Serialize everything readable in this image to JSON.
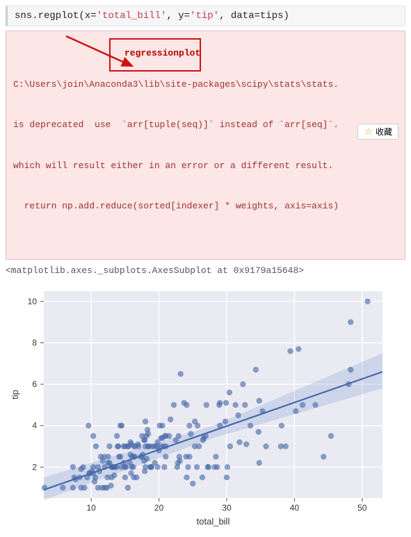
{
  "code": {
    "prefix": "sns.regplot(x=",
    "arg1": "'total_bill'",
    "sep1": ", y=",
    "arg2": "'tip'",
    "sep2": ", data=tips)"
  },
  "warning": {
    "line1": "C:\\Users\\join\\Anaconda3\\lib\\site-packages\\scipy\\stats\\stats.",
    "line2": "is deprecated  use  `arr[tuple(seq)]` instead of `arr[seq]`.",
    "line3": "which will result either in an error or a different result.",
    "line4": "  return np.add.reduce(sorted[indexer] * weights, axis=axis)"
  },
  "annotation": {
    "label": "regressionplot"
  },
  "repr_text": "<matplotlib.axes._subplots.AxesSubplot at 0x9179a15648>",
  "fav_label": "收藏",
  "chart_data": {
    "type": "scatter",
    "xlabel": "total_bill",
    "ylabel": "tip",
    "xlim": [
      3,
      53
    ],
    "ylim": [
      0.5,
      10.5
    ],
    "xticks": [
      10,
      20,
      30,
      40,
      50
    ],
    "yticks": [
      2,
      4,
      6,
      8,
      10
    ],
    "reg_line": {
      "x0": 3,
      "y0": 0.9,
      "x1": 53,
      "y1": 6.6
    },
    "reg_band": [
      {
        "x": 3,
        "lo": 0.4,
        "hi": 1.5
      },
      {
        "x": 28,
        "lo": 3.4,
        "hi": 4.0
      },
      {
        "x": 53,
        "lo": 5.8,
        "hi": 7.5
      }
    ],
    "points": [
      [
        3.1,
        1.0
      ],
      [
        5.8,
        1.0
      ],
      [
        7.3,
        1.0
      ],
      [
        7.3,
        2.0
      ],
      [
        7.5,
        1.5
      ],
      [
        7.7,
        1.4
      ],
      [
        8.3,
        1.5
      ],
      [
        8.5,
        1.0
      ],
      [
        8.5,
        1.9
      ],
      [
        8.8,
        2.0
      ],
      [
        9.0,
        1.0
      ],
      [
        9.4,
        1.5
      ],
      [
        9.6,
        4.0
      ],
      [
        9.7,
        1.7
      ],
      [
        9.8,
        1.7
      ],
      [
        10.1,
        1.8
      ],
      [
        10.3,
        1.7
      ],
      [
        10.3,
        2.0
      ],
      [
        10.3,
        3.5
      ],
      [
        10.5,
        1.3
      ],
      [
        10.6,
        1.5
      ],
      [
        10.7,
        3.0
      ],
      [
        11.0,
        1.0
      ],
      [
        11.0,
        2.0
      ],
      [
        11.2,
        1.8
      ],
      [
        11.4,
        2.5
      ],
      [
        11.6,
        1.0
      ],
      [
        11.7,
        2.3
      ],
      [
        11.9,
        2.5
      ],
      [
        12.0,
        1.0
      ],
      [
        12.0,
        2.0
      ],
      [
        12.3,
        1.0
      ],
      [
        12.4,
        1.5
      ],
      [
        12.5,
        2.5
      ],
      [
        12.5,
        2.2
      ],
      [
        12.7,
        2.2
      ],
      [
        12.7,
        3.0
      ],
      [
        12.9,
        1.1
      ],
      [
        13.0,
        1.5
      ],
      [
        13.0,
        2.0
      ],
      [
        13.1,
        2.0
      ],
      [
        13.3,
        2.0
      ],
      [
        13.4,
        2.0
      ],
      [
        13.4,
        1.6
      ],
      [
        13.5,
        2.0
      ],
      [
        13.8,
        2.0
      ],
      [
        13.8,
        3.5
      ],
      [
        13.9,
        3.0
      ],
      [
        14.0,
        3.0
      ],
      [
        14.1,
        2.5
      ],
      [
        14.3,
        2.5
      ],
      [
        14.3,
        4.0
      ],
      [
        14.5,
        4.0
      ],
      [
        14.5,
        2.0
      ],
      [
        14.8,
        2.2
      ],
      [
        14.8,
        3.0
      ],
      [
        15.0,
        2.0
      ],
      [
        15.0,
        1.5
      ],
      [
        15.0,
        3.0
      ],
      [
        15.1,
        2.0
      ],
      [
        15.4,
        1.0
      ],
      [
        15.4,
        3.0
      ],
      [
        15.5,
        3.0
      ],
      [
        15.7,
        2.2
      ],
      [
        15.8,
        2.6
      ],
      [
        15.8,
        3.2
      ],
      [
        15.9,
        1.7
      ],
      [
        15.9,
        3.1
      ],
      [
        16.0,
        2.0
      ],
      [
        16.0,
        2.5
      ],
      [
        16.2,
        2.0
      ],
      [
        16.3,
        2.5
      ],
      [
        16.3,
        3.0
      ],
      [
        16.3,
        1.5
      ],
      [
        16.4,
        2.5
      ],
      [
        16.5,
        3.0
      ],
      [
        16.7,
        1.5
      ],
      [
        16.9,
        3.1
      ],
      [
        17.0,
        3.0
      ],
      [
        17.3,
        2.5
      ],
      [
        17.5,
        3.5
      ],
      [
        17.5,
        2.5
      ],
      [
        17.6,
        2.6
      ],
      [
        17.8,
        2.3
      ],
      [
        17.8,
        3.3
      ],
      [
        17.9,
        1.8
      ],
      [
        17.9,
        3.3
      ],
      [
        18.0,
        2.0
      ],
      [
        18.0,
        4.2
      ],
      [
        18.0,
        3.0
      ],
      [
        18.1,
        3.5
      ],
      [
        18.2,
        2.4
      ],
      [
        18.3,
        3.8
      ],
      [
        18.4,
        3.0
      ],
      [
        18.4,
        3.6
      ],
      [
        18.5,
        3.0
      ],
      [
        18.7,
        2.0
      ],
      [
        18.8,
        2.0
      ],
      [
        18.9,
        2.0
      ],
      [
        19.0,
        3.0
      ],
      [
        19.4,
        2.2
      ],
      [
        19.4,
        3.0
      ],
      [
        19.7,
        3.0
      ],
      [
        19.8,
        2.0
      ],
      [
        19.8,
        3.2
      ],
      [
        20.0,
        2.8
      ],
      [
        20.1,
        4.0
      ],
      [
        20.3,
        3.0
      ],
      [
        20.3,
        3.4
      ],
      [
        20.5,
        4.0
      ],
      [
        20.5,
        3.4
      ],
      [
        20.7,
        3.0
      ],
      [
        20.8,
        2.0
      ],
      [
        20.9,
        3.5
      ],
      [
        21.0,
        3.0
      ],
      [
        21.0,
        3.5
      ],
      [
        21.0,
        2.5
      ],
      [
        21.5,
        3.5
      ],
      [
        21.7,
        4.3
      ],
      [
        22.2,
        5.0
      ],
      [
        22.5,
        3.3
      ],
      [
        22.7,
        2.0
      ],
      [
        22.8,
        2.2
      ],
      [
        22.9,
        3.5
      ],
      [
        23.0,
        2.5
      ],
      [
        23.1,
        2.3
      ],
      [
        23.2,
        6.5
      ],
      [
        23.7,
        5.1
      ],
      [
        24.0,
        2.5
      ],
      [
        24.1,
        1.5
      ],
      [
        24.1,
        5.0
      ],
      [
        24.3,
        2.0
      ],
      [
        24.5,
        2.5
      ],
      [
        24.5,
        4.0
      ],
      [
        24.7,
        3.6
      ],
      [
        25.0,
        1.2
      ],
      [
        25.3,
        3.0
      ],
      [
        25.3,
        4.2
      ],
      [
        25.6,
        2.0
      ],
      [
        25.7,
        4.0
      ],
      [
        25.9,
        3.0
      ],
      [
        26.4,
        1.5
      ],
      [
        26.5,
        3.3
      ],
      [
        26.6,
        3.4
      ],
      [
        26.9,
        3.5
      ],
      [
        27.0,
        5.0
      ],
      [
        27.2,
        2.0
      ],
      [
        27.3,
        2.0
      ],
      [
        28.2,
        2.0
      ],
      [
        28.4,
        2.5
      ],
      [
        28.6,
        2.0
      ],
      [
        28.9,
        5.0
      ],
      [
        29.0,
        4.0
      ],
      [
        29.0,
        5.1
      ],
      [
        29.8,
        4.2
      ],
      [
        29.9,
        5.1
      ],
      [
        30.0,
        1.5
      ],
      [
        30.1,
        2.0
      ],
      [
        30.4,
        5.6
      ],
      [
        30.5,
        3.0
      ],
      [
        31.3,
        5.0
      ],
      [
        31.7,
        4.5
      ],
      [
        31.9,
        3.2
      ],
      [
        32.4,
        6.0
      ],
      [
        32.7,
        5.0
      ],
      [
        32.9,
        3.1
      ],
      [
        33.5,
        4.0
      ],
      [
        34.3,
        6.7
      ],
      [
        34.7,
        3.7
      ],
      [
        34.8,
        2.2
      ],
      [
        34.8,
        5.2
      ],
      [
        35.3,
        4.7
      ],
      [
        35.8,
        3.0
      ],
      [
        38.0,
        3.0
      ],
      [
        38.1,
        4.0
      ],
      [
        38.7,
        3.0
      ],
      [
        39.4,
        7.6
      ],
      [
        40.2,
        4.7
      ],
      [
        40.6,
        7.7
      ],
      [
        41.2,
        5.0
      ],
      [
        43.1,
        5.0
      ],
      [
        44.3,
        2.5
      ],
      [
        45.4,
        3.5
      ],
      [
        48.0,
        6.0
      ],
      [
        48.3,
        6.7
      ],
      [
        48.3,
        9.0
      ],
      [
        50.8,
        10.0
      ]
    ]
  }
}
